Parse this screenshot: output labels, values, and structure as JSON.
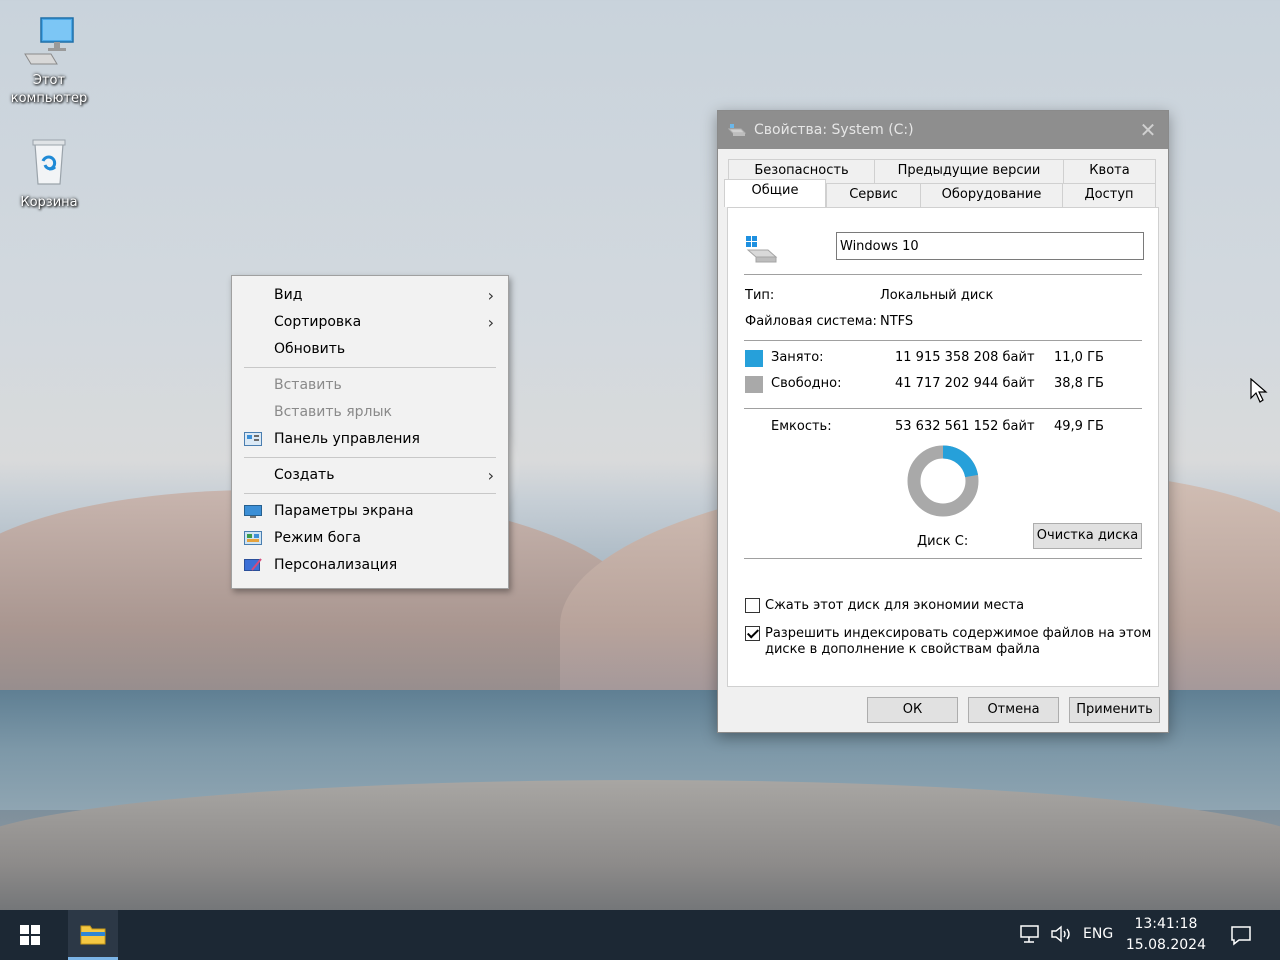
{
  "desktop": {
    "icons": [
      {
        "label_line1": "Этот",
        "label_line2": "компьютер",
        "icon": "this-pc-icon"
      },
      {
        "label_line1": "Корзина",
        "label_line2": "",
        "icon": "recycle-bin-icon"
      }
    ]
  },
  "context_menu": {
    "items": [
      {
        "label": "Вид"
      },
      {
        "label": "Сортировка"
      },
      {
        "label": "Обновить"
      },
      {
        "label": "Вставить"
      },
      {
        "label": "Вставить ярлык"
      },
      {
        "label": "Панель управления"
      },
      {
        "label": "Создать"
      },
      {
        "label": "Параметры экрана"
      },
      {
        "label": "Режим бога"
      },
      {
        "label": "Персонализация"
      }
    ]
  },
  "dialog": {
    "title": "Свойства: System (C:)",
    "close_glyph": "✕",
    "tabs_row1": [
      "Безопасность",
      "Предыдущие версии",
      "Квота"
    ],
    "tabs_row2": [
      "Общие",
      "Сервис",
      "Оборудование",
      "Доступ"
    ],
    "drive_name": "Windows 10",
    "type_label": "Тип:",
    "type_value": "Локальный диск",
    "fs_label": "Файловая система:",
    "fs_value": "NTFS",
    "used_label": "Занято:",
    "used_bytes": "11 915 358 208 байт",
    "used_gb": "11,0 ГБ",
    "free_label": "Свободно:",
    "free_bytes": "41 717 202 944 байт",
    "free_gb": "38,8 ГБ",
    "capacity_label": "Емкость:",
    "capacity_bytes": "53 632 561 152 байт",
    "capacity_gb": "49,9 ГБ",
    "disk_label": "Диск C:",
    "cleanup_button": "Очистка диска",
    "used_fraction": 0.222,
    "used_color": "#26a0da",
    "free_color": "#a9a9a9",
    "compress_label": "Сжать этот диск для экономии места",
    "compress_checked": false,
    "index_label_line1": "Разрешить индексировать содержимое файлов на этом",
    "index_label_line2": "диске в дополнение к свойствам файла",
    "index_checked": true,
    "ok_button": "ОК",
    "cancel_button": "Отмена",
    "apply_button": "Применить"
  },
  "taskbar": {
    "lang": "ENG",
    "time": "13:41:18",
    "date": "15.08.2024"
  }
}
